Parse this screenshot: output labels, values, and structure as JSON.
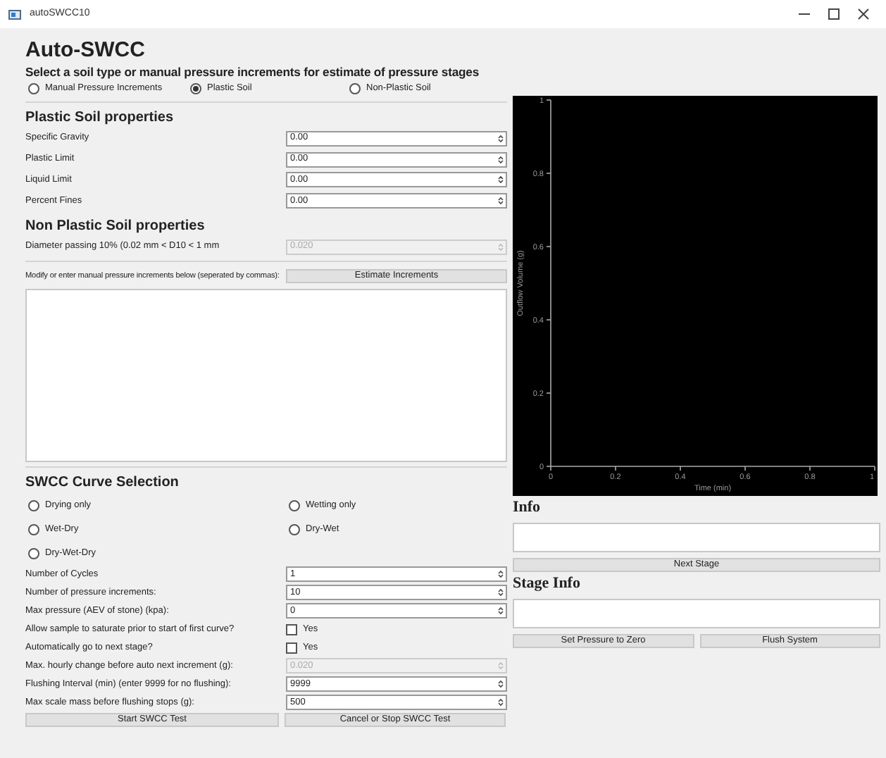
{
  "window": {
    "title": "autoSWCC10"
  },
  "title": "Auto-SWCC",
  "soil_type": {
    "heading": "Select a soil type or manual pressure increments for estimate of pressure stages",
    "options": [
      {
        "label": "Manual Pressure Increments",
        "selected": false
      },
      {
        "label": "Plastic Soil",
        "selected": true
      },
      {
        "label": "Non-Plastic Soil",
        "selected": false
      }
    ]
  },
  "plastic_soil": {
    "heading": "Plastic Soil properties",
    "fields": [
      {
        "label": "Specific Gravity",
        "value": "0.00",
        "disabled": false
      },
      {
        "label": "Plastic Limit",
        "value": "0.00",
        "disabled": false
      },
      {
        "label": "Liquid Limit",
        "value": "0.00",
        "disabled": false
      },
      {
        "label": "Percent Fines",
        "value": "0.00",
        "disabled": false
      }
    ]
  },
  "non_plastic_soil": {
    "heading": "Non Plastic Soil properties",
    "fields": [
      {
        "label": "Diameter passing 10% (0.02 mm < D10 < 1 mm",
        "value": "0.020",
        "disabled": true
      }
    ]
  },
  "increments": {
    "label": "Modify or enter manual pressure increments below (seperated by commas):",
    "button": "Estimate Increments"
  },
  "curve_selection": {
    "heading": "SWCC Curve Selection",
    "options": [
      {
        "label": "Drying only",
        "selected": false
      },
      {
        "label": "Wetting only",
        "selected": false
      },
      {
        "label": "Wet-Dry",
        "selected": false
      },
      {
        "label": "Dry-Wet",
        "selected": false
      },
      {
        "label": "Dry-Wet-Dry",
        "selected": false
      }
    ]
  },
  "settings": [
    {
      "kind": "spin",
      "label": "Number of Cycles",
      "value": "1",
      "disabled": false
    },
    {
      "kind": "spin",
      "label": "Number of pressure increments:",
      "value": "10",
      "disabled": false
    },
    {
      "kind": "spin",
      "label": "Max pressure (AEV of stone) (kpa):",
      "value": "0",
      "disabled": false
    },
    {
      "kind": "checkbox",
      "label": "Allow sample to saturate prior to start of first curve?",
      "option": "Yes",
      "checked": false
    },
    {
      "kind": "checkbox",
      "label": "Automatically go to next stage?",
      "option": "Yes",
      "checked": false
    },
    {
      "kind": "spin",
      "label": "Max. hourly change before auto next increment (g):",
      "value": "0.020",
      "disabled": true
    },
    {
      "kind": "spin",
      "label": "Flushing Interval (min) (enter 9999 for no flushing):",
      "value": "9999",
      "disabled": false
    },
    {
      "kind": "spin",
      "label": "Max scale mass before flushing stops (g):",
      "value": "500",
      "disabled": false
    }
  ],
  "buttons": [
    "Start SWCC Test",
    "Cancel or Stop SWCC Test"
  ],
  "chart": {
    "chart_data": {
      "type": "line",
      "xlabel": "Time (min)",
      "ylabel": "Outflow Volume (g)",
      "xlim": [
        0,
        1
      ],
      "ylim": [
        0,
        1
      ],
      "xticks": [
        0,
        0.2,
        0.4,
        0.6,
        0.8,
        1
      ],
      "yticks": [
        0,
        0.2,
        0.4,
        0.6,
        0.8,
        1
      ]
    }
  },
  "info": {
    "heading": "Info",
    "button": "Next Stage"
  },
  "stage_info": {
    "heading": "Stage Info",
    "buttons": [
      "Set Pressure to Zero",
      "Flush System"
    ]
  }
}
